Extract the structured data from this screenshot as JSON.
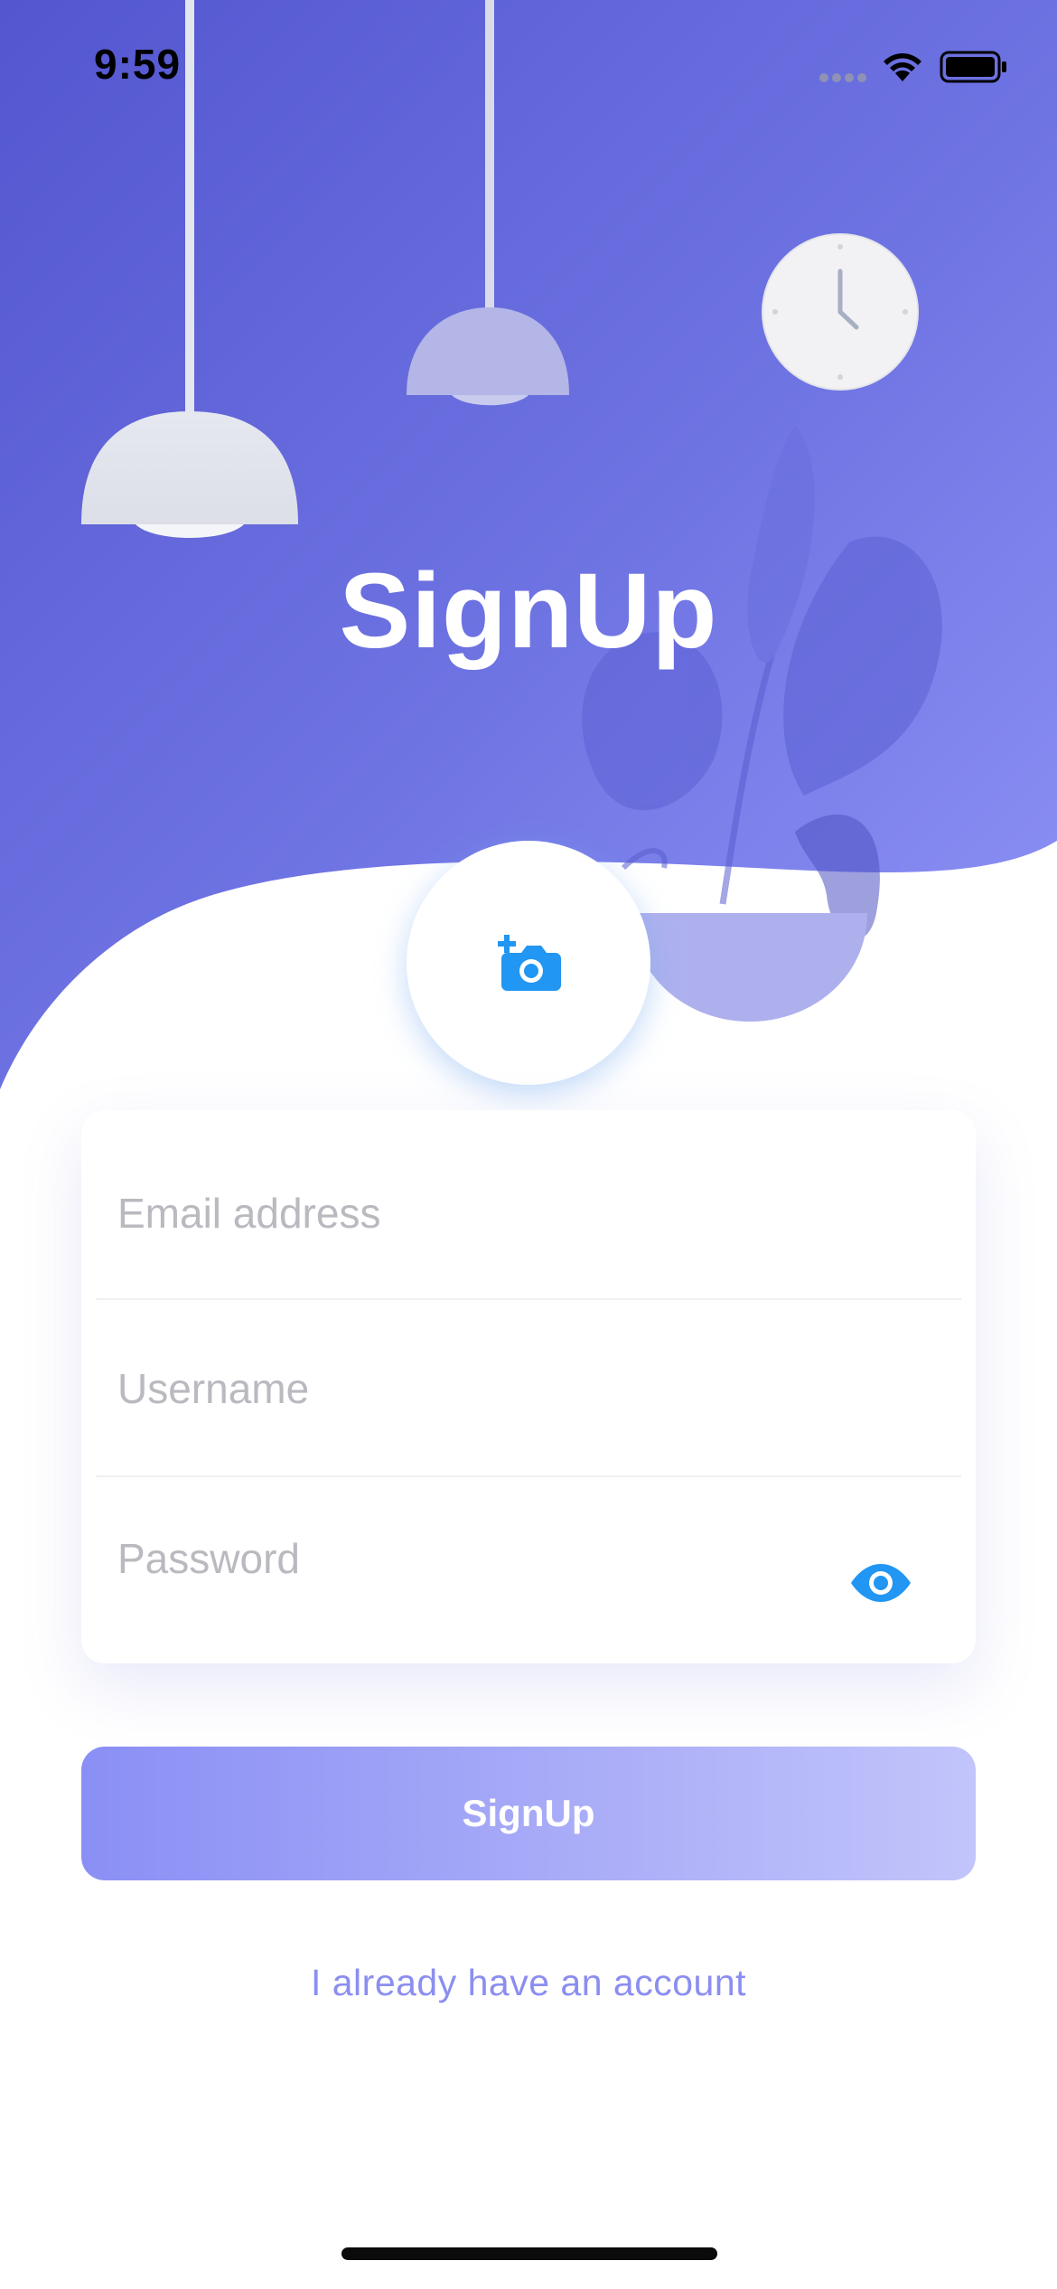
{
  "status_bar": {
    "time": "9:59"
  },
  "header": {
    "title": "SignUp"
  },
  "photo_picker": {
    "icon": "camera-plus-icon"
  },
  "form": {
    "email": {
      "placeholder": "Email address",
      "value": ""
    },
    "username": {
      "placeholder": "Username",
      "value": ""
    },
    "password": {
      "placeholder": "Password",
      "value": "",
      "toggle_icon": "eye-icon"
    }
  },
  "actions": {
    "signup_label": "SignUp",
    "signin_link": "I already have an account"
  },
  "colors": {
    "accent": "#5A5DD6",
    "accent_light": "#8A8FF5",
    "icon_blue": "#2196F3",
    "link": "#8B8EF0"
  }
}
